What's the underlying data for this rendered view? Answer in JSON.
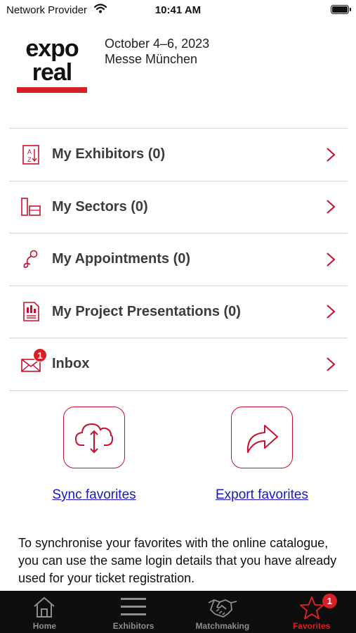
{
  "status_bar": {
    "carrier": "Network Provider",
    "time": "10:41 AM"
  },
  "header": {
    "logo": "expo real",
    "date": "October 4–6, 2023",
    "venue": "Messe München"
  },
  "menu": {
    "items": [
      {
        "label": "My Exhibitors (0)",
        "icon": "az-list-icon"
      },
      {
        "label": "My Sectors (0)",
        "icon": "sectors-icon"
      },
      {
        "label": "My Appointments (0)",
        "icon": "appointment-icon"
      },
      {
        "label": "My Project Presentations (0)",
        "icon": "presentation-icon"
      },
      {
        "label": "Inbox",
        "icon": "mail-icon",
        "badge": "1"
      }
    ]
  },
  "actions": {
    "sync_label": "Sync favorites",
    "export_label": "Export favorites"
  },
  "info": {
    "text": "To synchronise your favorites with the online catalogue, you can use the same login details that you have already used for your ticket registration."
  },
  "tabbar": {
    "tabs": [
      {
        "label": "Home",
        "icon": "home-icon"
      },
      {
        "label": "Exhibitors",
        "icon": "hamburger-icon"
      },
      {
        "label": "Matchmaking",
        "icon": "handshake-icon"
      },
      {
        "label": "Favorites",
        "icon": "star-icon",
        "badge": "1",
        "active": true
      }
    ]
  },
  "colors": {
    "accent": "#d91f26",
    "link": "#1a16c8",
    "tabbar_bg": "#0e0e0e"
  }
}
